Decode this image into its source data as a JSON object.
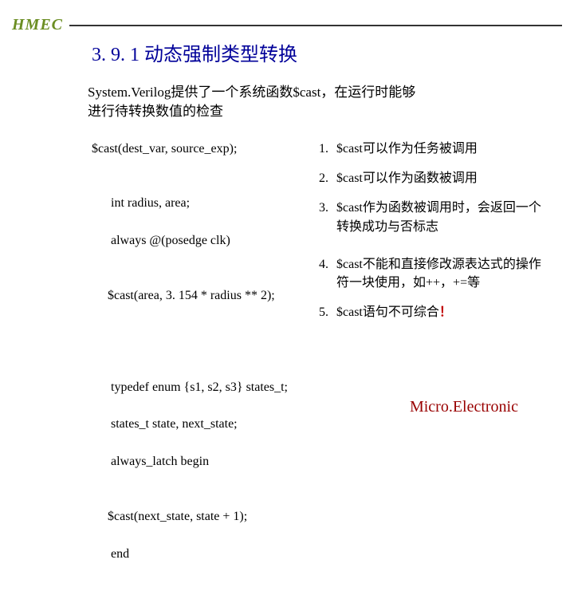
{
  "brand": "HMEC",
  "title": "3. 9. 1 动态强制类型转换",
  "intro_line1": "System.Verilog提供了一个系统函数$cast，在运行时能够",
  "intro_line2": "进行待转换数值的检查",
  "code": {
    "block1": "$cast(dest_var, source_exp);",
    "block2_l1": "int radius, area;",
    "block2_l2": "always @(posedge clk)",
    "block2_l3": "$cast(area, 3. 154 * radius ** 2);",
    "block3_l1": "typedef enum {s1, s2, s3} states_t;",
    "block3_l2": "states_t state, next_state;",
    "block3_l3": "always_latch begin",
    "block3_l4": "$cast(next_state, state + 1);",
    "block3_l5": "end"
  },
  "notes": {
    "n1": {
      "num": "1.",
      "txt": "$cast可以作为任务被调用"
    },
    "n2": {
      "num": "2.",
      "txt": "$cast可以作为函数被调用"
    },
    "n3": {
      "num": "3.",
      "txt": "$cast作为函数被调用时，会返回一个转换成功与否标志"
    },
    "n4": {
      "num": "4.",
      "txt": "$cast不能和直接修改源表达式的操作符一块使用，如++，+=等"
    },
    "n5": {
      "num": "5.",
      "txt": "$cast语句不可综合",
      "mark": "！"
    }
  },
  "footer": "Micro.Electronic"
}
